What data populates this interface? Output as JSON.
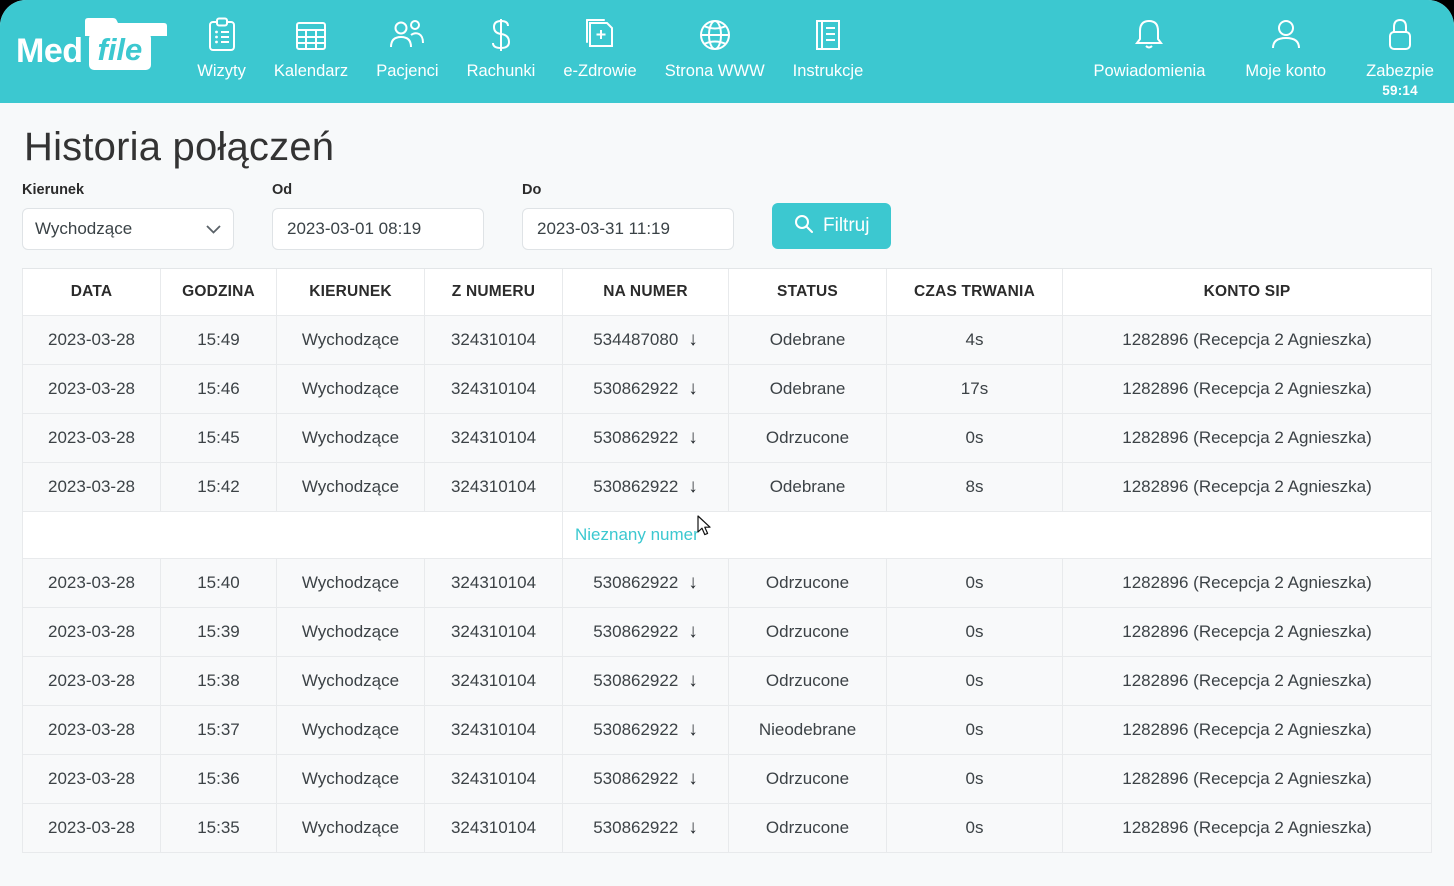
{
  "brand": {
    "part1": "Med",
    "part2": "file"
  },
  "nav": {
    "items": [
      {
        "label": "Wizyty",
        "icon": "clipboard-list-icon"
      },
      {
        "label": "Kalendarz",
        "icon": "calendar-icon"
      },
      {
        "label": "Pacjenci",
        "icon": "patients-icon"
      },
      {
        "label": "Rachunki",
        "icon": "dollar-icon"
      },
      {
        "label": "e-Zdrowie",
        "icon": "e-health-icon"
      },
      {
        "label": "Strona WWW",
        "icon": "globe-icon"
      },
      {
        "label": "Instrukcje",
        "icon": "book-icon"
      }
    ],
    "right": [
      {
        "label": "Powiadomienia",
        "icon": "bell-icon"
      },
      {
        "label": "Moje konto",
        "icon": "user-icon"
      },
      {
        "label": "Zabezpie",
        "icon": "lock-icon"
      }
    ],
    "session_timer": "59:14"
  },
  "page": {
    "title": "Historia połączeń"
  },
  "filters": {
    "kierunek_label": "Kierunek",
    "kierunek_value": "Wychodzące",
    "od_label": "Od",
    "od_value": "2023-03-01 08:19",
    "do_label": "Do",
    "do_value": "2023-03-31 11:19",
    "filter_button": "Filtruj",
    "search_icon": "search-icon"
  },
  "table": {
    "headers": [
      "DATA",
      "GODZINA",
      "KIERUNEK",
      "Z NUMERU",
      "NA NUMER",
      "STATUS",
      "CZAS TRWANIA",
      "KONTO SIP"
    ],
    "arrow_glyph": "↓",
    "expanded_text": "Nieznany numer",
    "rows": [
      {
        "data": "2023-03-28",
        "godzina": "15:49",
        "kierunek": "Wychodzące",
        "z_numeru": "324310104",
        "na_numer": "534487080",
        "status": "Odebrane",
        "status_kind": "odebrane",
        "czas": "4s",
        "konto": "1282896 (Recepcja 2 Agnieszka)"
      },
      {
        "data": "2023-03-28",
        "godzina": "15:46",
        "kierunek": "Wychodzące",
        "z_numeru": "324310104",
        "na_numer": "530862922",
        "status": "Odebrane",
        "status_kind": "odebrane",
        "czas": "17s",
        "konto": "1282896 (Recepcja 2 Agnieszka)"
      },
      {
        "data": "2023-03-28",
        "godzina": "15:45",
        "kierunek": "Wychodzące",
        "z_numeru": "324310104",
        "na_numer": "530862922",
        "status": "Odrzucone",
        "status_kind": "odrzucone",
        "czas": "0s",
        "konto": "1282896 (Recepcja 2 Agnieszka)"
      },
      {
        "data": "2023-03-28",
        "godzina": "15:42",
        "kierunek": "Wychodzące",
        "z_numeru": "324310104",
        "na_numer": "530862922",
        "status": "Odebrane",
        "status_kind": "odebrane",
        "czas": "8s",
        "konto": "1282896 (Recepcja 2 Agnieszka)",
        "expanded": true
      },
      {
        "data": "2023-03-28",
        "godzina": "15:40",
        "kierunek": "Wychodzące",
        "z_numeru": "324310104",
        "na_numer": "530862922",
        "status": "Odrzucone",
        "status_kind": "odrzucone",
        "czas": "0s",
        "konto": "1282896 (Recepcja 2 Agnieszka)"
      },
      {
        "data": "2023-03-28",
        "godzina": "15:39",
        "kierunek": "Wychodzące",
        "z_numeru": "324310104",
        "na_numer": "530862922",
        "status": "Odrzucone",
        "status_kind": "odrzucone",
        "czas": "0s",
        "konto": "1282896 (Recepcja 2 Agnieszka)"
      },
      {
        "data": "2023-03-28",
        "godzina": "15:38",
        "kierunek": "Wychodzące",
        "z_numeru": "324310104",
        "na_numer": "530862922",
        "status": "Odrzucone",
        "status_kind": "odrzucone",
        "czas": "0s",
        "konto": "1282896 (Recepcja 2 Agnieszka)"
      },
      {
        "data": "2023-03-28",
        "godzina": "15:37",
        "kierunek": "Wychodzące",
        "z_numeru": "324310104",
        "na_numer": "530862922",
        "status": "Nieodebrane",
        "status_kind": "nieodebrane",
        "czas": "0s",
        "konto": "1282896 (Recepcja 2 Agnieszka)"
      },
      {
        "data": "2023-03-28",
        "godzina": "15:36",
        "kierunek": "Wychodzące",
        "z_numeru": "324310104",
        "na_numer": "530862922",
        "status": "Odrzucone",
        "status_kind": "odrzucone",
        "czas": "0s",
        "konto": "1282896 (Recepcja 2 Agnieszka)"
      },
      {
        "data": "2023-03-28",
        "godzina": "15:35",
        "kierunek": "Wychodzące",
        "z_numeru": "324310104",
        "na_numer": "530862922",
        "status": "Odrzucone",
        "status_kind": "odrzucone",
        "czas": "0s",
        "konto": "1282896 (Recepcja 2 Agnieszka)"
      }
    ]
  },
  "colors": {
    "brand_teal": "#3cc8d0",
    "status_answered": "#3a8a4f",
    "status_rejected": "#24a1f0",
    "status_missed": "#e8356d",
    "page_bg": "#f7f9fa"
  }
}
